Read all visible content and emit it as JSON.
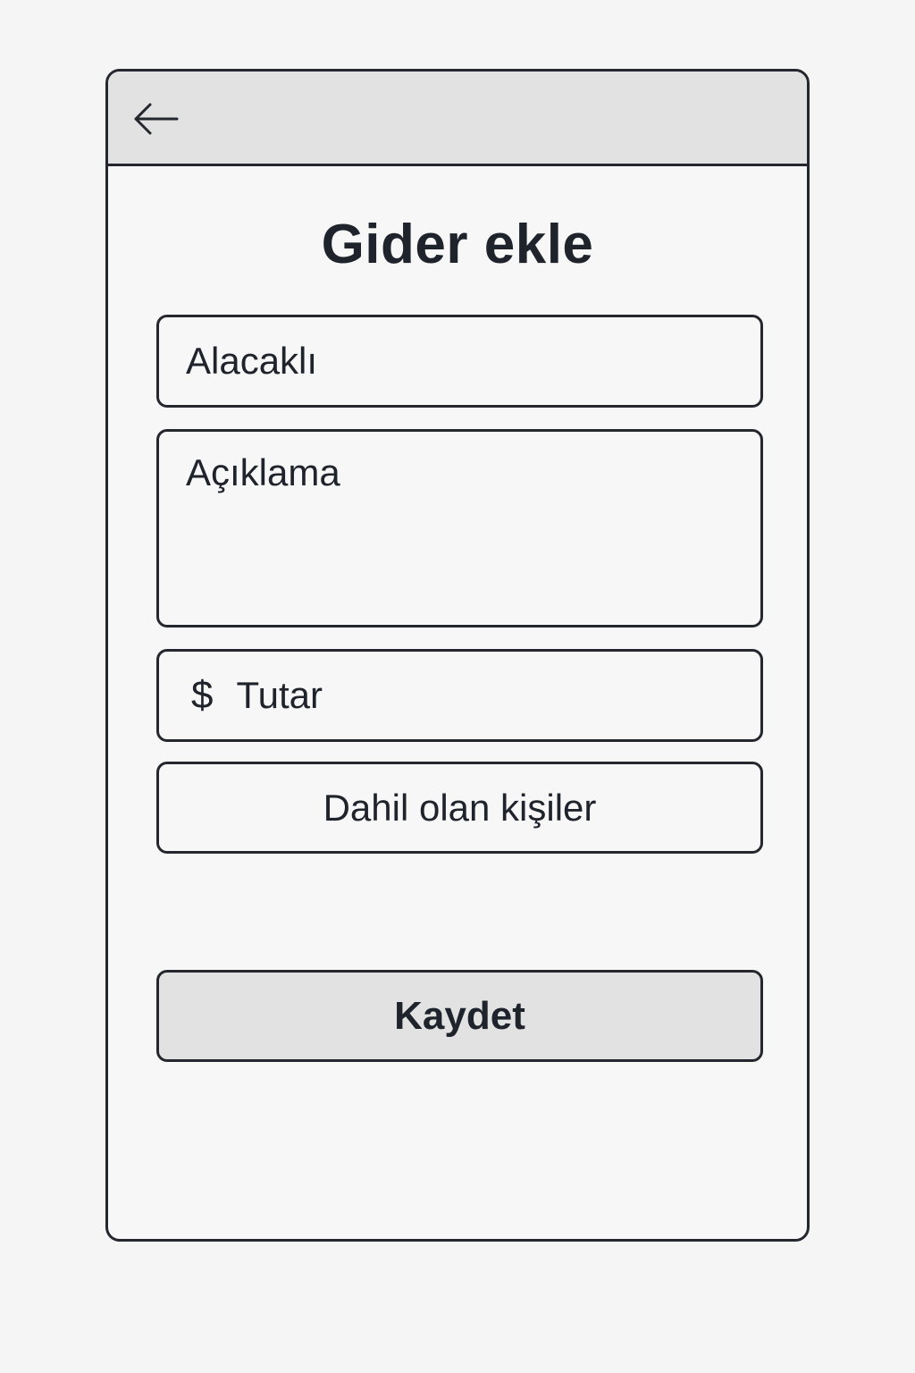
{
  "header": {
    "back_icon": "arrow-left-icon"
  },
  "page": {
    "title": "Gider ekle"
  },
  "form": {
    "creditor_placeholder": "Alacaklı",
    "description_placeholder": "Açıklama",
    "currency_symbol": "$",
    "amount_placeholder": "Tutar",
    "participants_label": "Dahil olan kişiler",
    "save_label": "Kaydet"
  },
  "colors": {
    "background": "#f5f5f5",
    "header_bg": "#e2e2e2",
    "border": "#24272e",
    "text": "#1f232b",
    "button_bg": "#e2e2e2"
  }
}
